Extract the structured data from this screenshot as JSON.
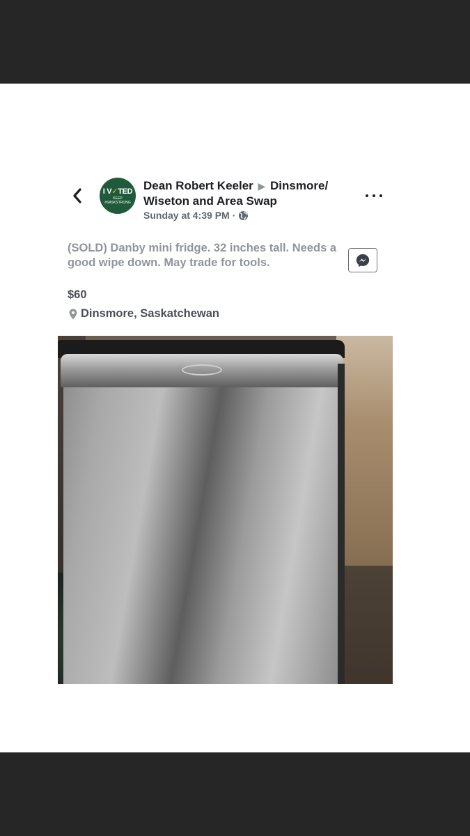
{
  "post": {
    "author": "Dean Robert Keeler",
    "group": "Dinsmore/ Wiseton and Area Swap",
    "timestamp": "Sunday at 4:39 PM",
    "separator": "·"
  },
  "avatar": {
    "line1_a": "I V",
    "line1_check": "✓",
    "line1_b": "TED",
    "line2": "KEEP",
    "line3": "#SASKSTRONG"
  },
  "listing": {
    "description": "(SOLD) Danby mini fridge.  32 inches tall. Needs a good wipe down. May trade for tools.",
    "price": "$60",
    "location": "Dinsmore, Saskatchewan"
  },
  "icons": {
    "back": "chevron-left-icon",
    "more": "more-horizontal-icon",
    "privacy": "globe-icon",
    "messenger": "messenger-icon",
    "location": "location-pin-icon"
  },
  "colors": {
    "bars": "#262626",
    "title": "#1c1e21",
    "muted": "#90949c",
    "secondary": "#4b4f56"
  }
}
